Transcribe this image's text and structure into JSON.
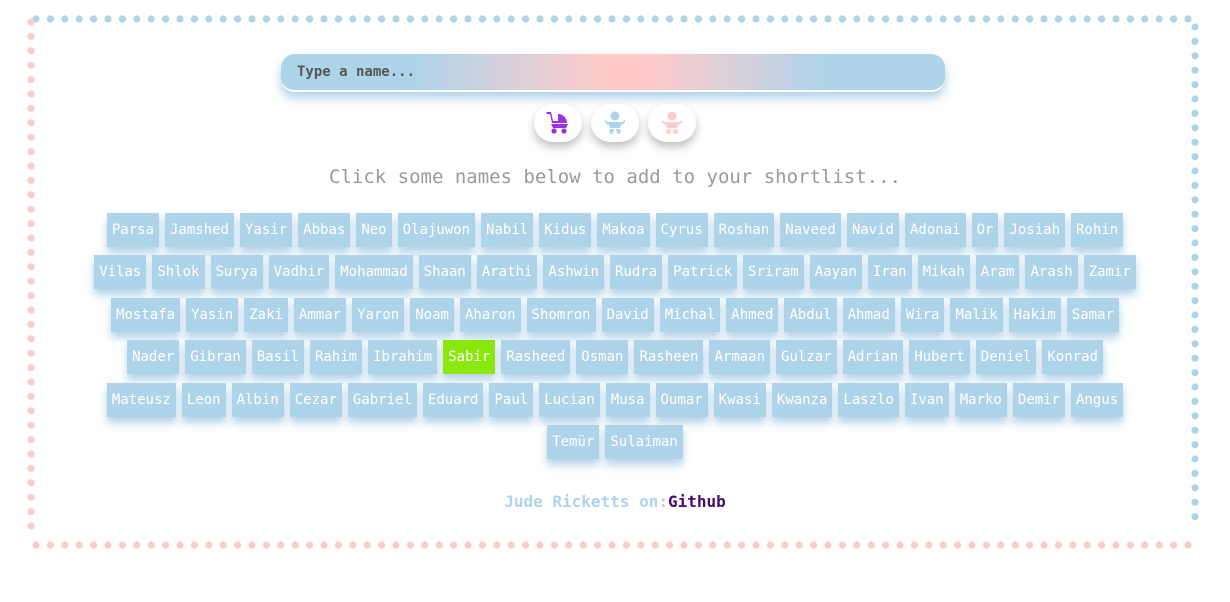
{
  "colors": {
    "blue": "#aed4ea",
    "pink": "#fecbca",
    "selected": "#8be80e",
    "link": "#4a0a6b",
    "stroller": "#9b30e6"
  },
  "search": {
    "placeholder": "Type a name..."
  },
  "filters": [
    {
      "icon": "stroller-icon",
      "label": "all"
    },
    {
      "icon": "baby-boy-icon",
      "label": "boy"
    },
    {
      "icon": "baby-girl-icon",
      "label": "girl"
    }
  ],
  "hint": "Click some names below to add to your shortlist...",
  "selected": "Sabir",
  "names": [
    [
      "Parsa",
      "Jamshed",
      "Yasir",
      "Abbas",
      "Neo",
      "Olajuwon",
      "Nabil",
      "Kidus",
      "Makoa",
      "Cyrus",
      "Roshan",
      "Naveed",
      "Navid",
      "Adonai",
      "Or",
      "Josiah",
      "Rohin"
    ],
    [
      "Vilas",
      "Shlok",
      "Surya",
      "Vadhir",
      "Mohammad",
      "Shaan",
      "Arathi",
      "Ashwin",
      "Rudra",
      "Patrick",
      "Sriram",
      "Aayan",
      "Iran",
      "Mikah",
      "Aram",
      "Arash",
      "Zamir"
    ],
    [
      "Mostafa",
      "Yasin",
      "Zaki",
      "Ammar",
      "Yaron",
      "Noam",
      "Aharon",
      "Shomron",
      "David",
      "Michal",
      "Ahmed",
      "Abdul",
      "Ahmad",
      "Wira",
      "Malik",
      "Hakim",
      "Samar"
    ],
    [
      "Nader",
      "Gibran",
      "Basil",
      "Rahim",
      "Ibrahim",
      "Sabir",
      "Rasheed",
      "Osman",
      "Rasheen",
      "Armaan",
      "Gulzar",
      "Adrian",
      "Hubert",
      "Deniel",
      "Konrad"
    ],
    [
      "Mateusz",
      "Leon",
      "Albin",
      "Cezar",
      "Gabriel",
      "Eduard",
      "Paul",
      "Lucian",
      "Musa",
      "Oumar",
      "Kwasi",
      "Kwanza",
      "Laszlo",
      "Ivan",
      "Marko",
      "Demir",
      "Angus"
    ],
    [
      "Temür",
      "Sulaiman"
    ]
  ],
  "footer": {
    "by": "Jude Ricketts on:",
    "link": "Github"
  }
}
